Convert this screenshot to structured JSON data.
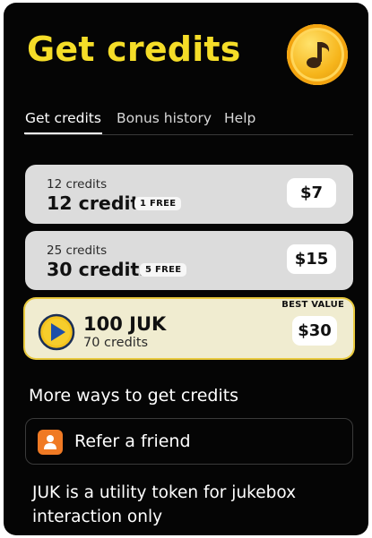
{
  "header": {
    "title": "Get credits",
    "coin_icon": "music-note-icon",
    "accent": "#f5dd28"
  },
  "tabs": [
    {
      "label": "Get credits",
      "active": true
    },
    {
      "label": "Bonus history",
      "active": false
    },
    {
      "label": "Help",
      "active": false
    }
  ],
  "packs": [
    {
      "sub": "12 credits",
      "main": "12 credits",
      "badge": "1 FREE",
      "price": "$7"
    },
    {
      "sub": "25 credits",
      "main": "30 credits",
      "badge": "5 FREE",
      "price": "$15"
    },
    {
      "tag": "BEST VALUE",
      "main": "100 JUK",
      "sub": "70 credits",
      "price": "$30",
      "icon": "play-icon"
    }
  ],
  "more": {
    "heading": "More ways to get credits",
    "refer_label": "Refer a friend",
    "refer_icon": "person-icon"
  },
  "note": "JUK is a utility token for jukebox interaction only"
}
